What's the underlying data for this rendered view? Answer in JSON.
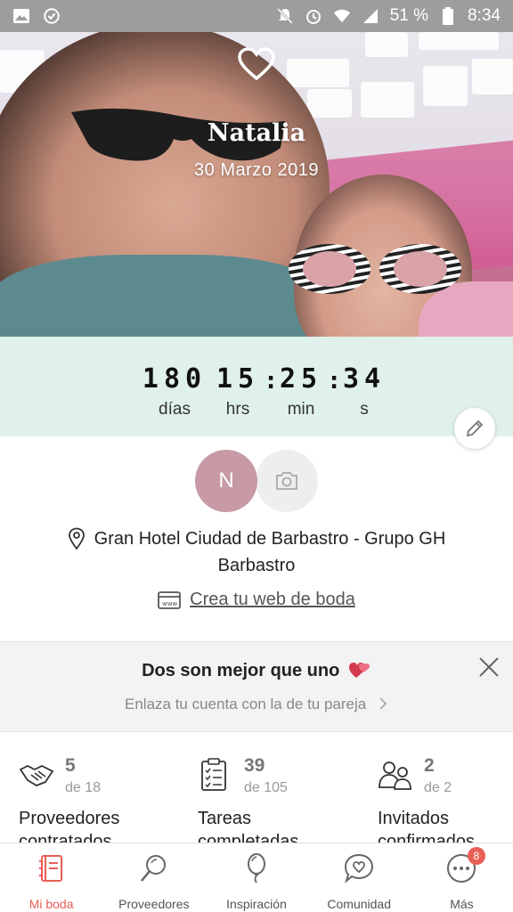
{
  "status_bar": {
    "battery": "51 %",
    "time": "8:34"
  },
  "hero": {
    "couple_name": "Natalia",
    "date": "30 Marzo 2019"
  },
  "countdown": [
    {
      "value": "180",
      "label": "días"
    },
    {
      "value": "15",
      "label": "hrs"
    },
    {
      "value": "25",
      "label": "min"
    },
    {
      "value": "34",
      "label": "s"
    }
  ],
  "avatar": {
    "initial": "N"
  },
  "venue": {
    "name": "Gran Hotel Ciudad de Barbastro - Grupo GH",
    "city": "Barbastro"
  },
  "web_link": "Crea tu web de boda",
  "banner": {
    "title": "Dos son mejor que uno",
    "subtitle": "Enlaza tu cuenta con la de tu pareja"
  },
  "stats": [
    {
      "value": "5",
      "of": "de 18",
      "label": "Proveedores contratados",
      "icon": "handshake-icon"
    },
    {
      "value": "39",
      "of": "de 105",
      "label": "Tareas completadas",
      "icon": "clipboard-icon"
    },
    {
      "value": "2",
      "of": "de 2",
      "label": "Invitados confirmados",
      "icon": "guests-icon"
    }
  ],
  "nav": [
    {
      "label": "Mi boda",
      "icon": "notebook-icon",
      "active": true
    },
    {
      "label": "Proveedores",
      "icon": "search-icon"
    },
    {
      "label": "Inspiración",
      "icon": "balloon-icon"
    },
    {
      "label": "Comunidad",
      "icon": "chat-heart-icon"
    },
    {
      "label": "Más",
      "icon": "more-icon",
      "badge": "8"
    }
  ],
  "colors": {
    "accent": "#e85f56",
    "countdown_bg": "#e0f1ec",
    "avatar": "#c79aa6"
  }
}
